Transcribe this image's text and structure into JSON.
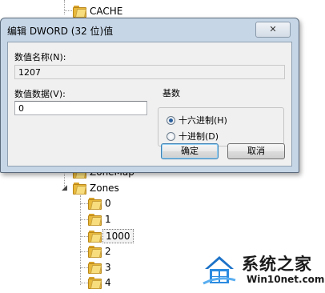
{
  "tree": {
    "items": [
      {
        "label": "CACHE"
      },
      {
        "label": "ZoneMap"
      },
      {
        "label": "Zones"
      },
      {
        "label": "0"
      },
      {
        "label": "1"
      },
      {
        "label": "1000"
      },
      {
        "label": "2"
      },
      {
        "label": "3"
      },
      {
        "label": "4"
      }
    ],
    "selected": "1000"
  },
  "dialog": {
    "title": "编辑 DWORD (32 位)值",
    "close_glyph": "✕",
    "value_name_label": "数值名称(N):",
    "value_name": "1207",
    "value_data_label": "数值数据(V):",
    "value_data": "0",
    "base_label": "基数",
    "base_options": [
      {
        "label": "十六进制(H)",
        "selected": true
      },
      {
        "label": "十进制(D)",
        "selected": false
      }
    ],
    "ok_label": "确定",
    "cancel_label": "取消"
  },
  "watermark": {
    "title": "系统之家",
    "url": "Win10net.com"
  }
}
